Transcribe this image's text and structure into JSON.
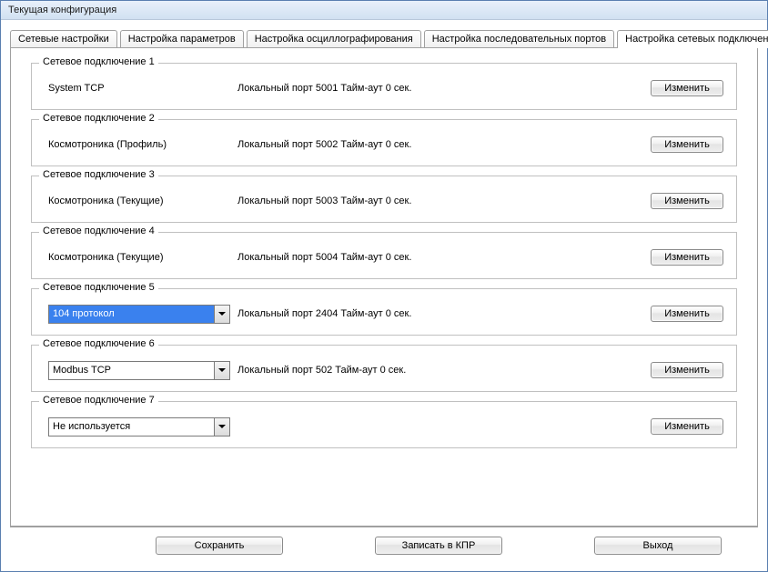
{
  "title": "Текущая конфигурация",
  "tabs": [
    {
      "label": "Сетевые настройки"
    },
    {
      "label": "Настройка параметров"
    },
    {
      "label": "Настройка осциллографирования"
    },
    {
      "label": "Настройка последовательных портов"
    },
    {
      "label": "Настройка сетевых подключений"
    }
  ],
  "groups": [
    {
      "title": "Сетевое подключение 1",
      "type": "label",
      "left": "System TCP",
      "mid": "Локальный порт 5001 Тайм-аут 0 сек.",
      "btn": "Изменить"
    },
    {
      "title": "Сетевое подключение 2",
      "type": "label",
      "left": "Космотроника (Профиль)",
      "mid": "Локальный порт 5002 Тайм-аут 0 сек.",
      "btn": "Изменить"
    },
    {
      "title": "Сетевое подключение 3",
      "type": "label",
      "left": "Космотроника (Текущие)",
      "mid": "Локальный порт 5003 Тайм-аут 0 сек.",
      "btn": "Изменить"
    },
    {
      "title": "Сетевое подключение 4",
      "type": "label",
      "left": "Космотроника (Текущие)",
      "mid": "Локальный порт 5004 Тайм-аут 0 сек.",
      "btn": "Изменить"
    },
    {
      "title": "Сетевое подключение 5",
      "type": "combo",
      "left": "104 протокол",
      "selected": true,
      "mid": "Локальный порт 2404 Тайм-аут 0 сек.",
      "btn": "Изменить"
    },
    {
      "title": "Сетевое подключение 6",
      "type": "combo",
      "left": "Modbus TCP",
      "selected": false,
      "mid": "Локальный порт 502 Тайм-аут 0 сек.",
      "btn": "Изменить"
    },
    {
      "title": "Сетевое подключение 7",
      "type": "combo",
      "left": "Не используется",
      "selected": false,
      "mid": "",
      "btn": "Изменить"
    }
  ],
  "footer": {
    "save": "Сохранить",
    "write": "Записать в КПР",
    "exit": "Выход"
  }
}
